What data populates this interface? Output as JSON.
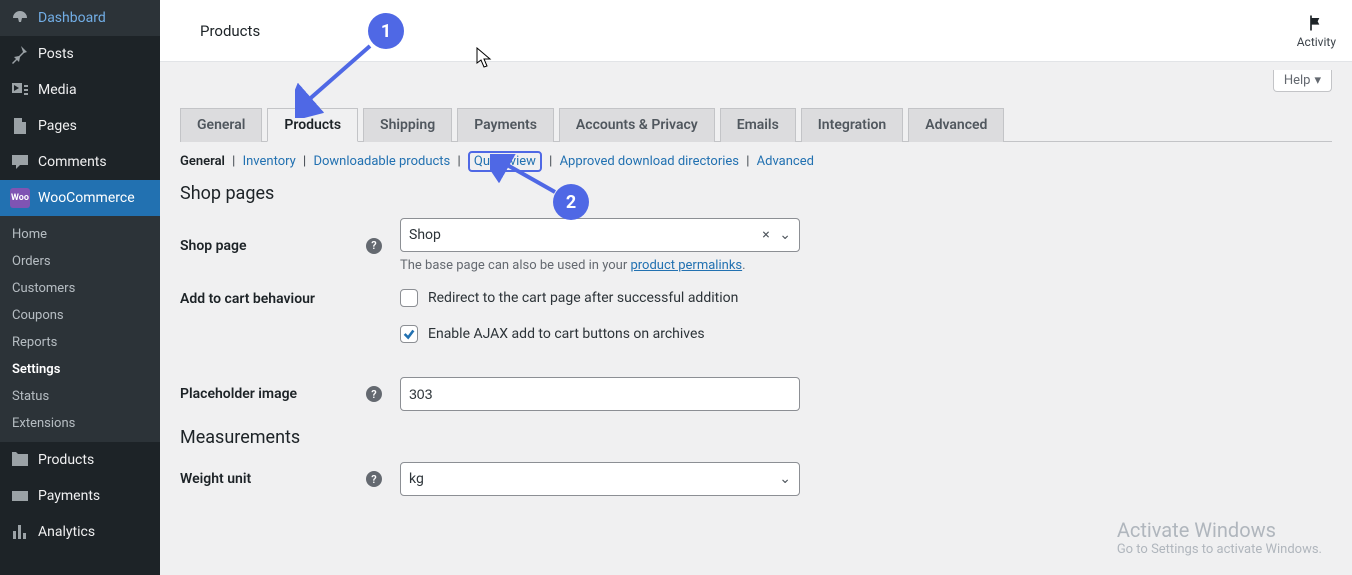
{
  "sidebar": {
    "items": [
      {
        "label": "Dashboard",
        "icon": "dashboard"
      },
      {
        "label": "Posts",
        "icon": "pin"
      },
      {
        "label": "Media",
        "icon": "media"
      },
      {
        "label": "Pages",
        "icon": "pages"
      },
      {
        "label": "Comments",
        "icon": "comments"
      },
      {
        "label": "WooCommerce",
        "icon": "woo"
      },
      {
        "label": "Products",
        "icon": "products"
      },
      {
        "label": "Payments",
        "icon": "payments"
      },
      {
        "label": "Analytics",
        "icon": "analytics"
      }
    ],
    "submenu": [
      {
        "label": "Home"
      },
      {
        "label": "Orders"
      },
      {
        "label": "Customers"
      },
      {
        "label": "Coupons"
      },
      {
        "label": "Reports"
      },
      {
        "label": "Settings"
      },
      {
        "label": "Status"
      },
      {
        "label": "Extensions"
      }
    ]
  },
  "topbar": {
    "title": "Products",
    "activity_label": "Activity"
  },
  "help_label": "Help",
  "tabs": [
    {
      "label": "General"
    },
    {
      "label": "Products"
    },
    {
      "label": "Shipping"
    },
    {
      "label": "Payments"
    },
    {
      "label": "Accounts & Privacy"
    },
    {
      "label": "Emails"
    },
    {
      "label": "Integration"
    },
    {
      "label": "Advanced"
    }
  ],
  "subtabs": {
    "general": "General",
    "inventory": "Inventory",
    "downloadable": "Downloadable products",
    "quickview": "Quick view",
    "approved": "Approved download directories",
    "advanced": "Advanced"
  },
  "sections": {
    "shop_pages": "Shop pages",
    "measurements": "Measurements"
  },
  "fields": {
    "shop_page": {
      "label": "Shop page",
      "value": "Shop",
      "desc_pre": "The base page can also be used in your ",
      "desc_link": "product permalinks",
      "desc_post": "."
    },
    "add_to_cart": {
      "label": "Add to cart behaviour",
      "redirect_label": "Redirect to the cart page after successful addition",
      "ajax_label": "Enable AJAX add to cart buttons on archives"
    },
    "placeholder": {
      "label": "Placeholder image",
      "value": "303"
    },
    "weight_unit": {
      "label": "Weight unit",
      "value": "kg"
    }
  },
  "annotations": {
    "one": "1",
    "two": "2"
  },
  "watermark": {
    "title": "Activate Windows",
    "sub": "Go to Settings to activate Windows."
  }
}
